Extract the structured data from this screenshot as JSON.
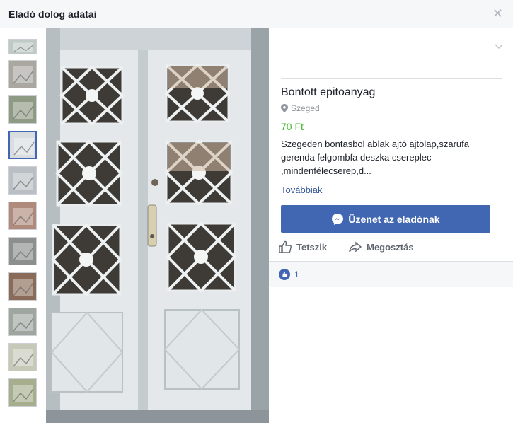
{
  "header": {
    "title": "Eladó dolog adatai",
    "close_icon": "close-icon"
  },
  "thumbnails": [
    {
      "tone": "#bfc9c5"
    },
    {
      "tone": "#a9a7a0"
    },
    {
      "tone": "#8f9a85"
    },
    {
      "tone": "#d9dde0",
      "active": true
    },
    {
      "tone": "#b9bfc4"
    },
    {
      "tone": "#b08a7c"
    },
    {
      "tone": "#8c8f8e"
    },
    {
      "tone": "#8a6a58"
    },
    {
      "tone": "#9fa6a0"
    },
    {
      "tone": "#c7c9b8"
    },
    {
      "tone": "#a7ae8d"
    }
  ],
  "listing": {
    "title": "Bontott epitoanyag",
    "location": "Szeged",
    "price": "70 Ft",
    "description": "Szegeden bontasbol ablak ajtó ajtolap,szarufa gerenda felgombfa deszka cserepleс ,mindenfélecserep,d...",
    "more_link": "Továbbiak"
  },
  "actions": {
    "message_button": "Üzenet az eladónak",
    "like": "Tetszik",
    "share": "Megosztás"
  },
  "likes": {
    "count": "1"
  },
  "colors": {
    "accent": "#4267b2",
    "price": "#42b72a",
    "link": "#365899"
  }
}
